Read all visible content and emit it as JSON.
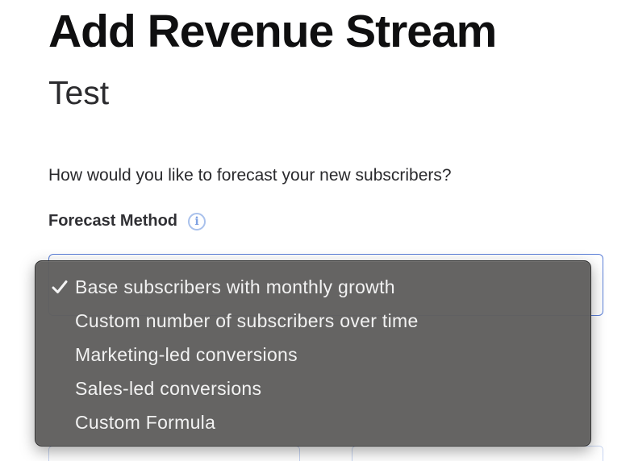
{
  "header": {
    "title": "Add Revenue Stream",
    "subtitle": "Test"
  },
  "form": {
    "question": "How would you like to forecast your new subscribers?",
    "forecast_method": {
      "label": "Forecast Method",
      "info_icon": "info-icon",
      "selected_value": "Base subscribers with monthly growth"
    }
  },
  "dropdown": {
    "items": [
      {
        "label": "Base subscribers with monthly growth",
        "checked": true
      },
      {
        "label": "Custom number of subscribers over time",
        "checked": false
      },
      {
        "label": "Marketing-led conversions",
        "checked": false
      },
      {
        "label": "Sales-led conversions",
        "checked": false
      },
      {
        "label": "Custom Formula",
        "checked": false
      }
    ],
    "check_icon": "checkmark-icon"
  },
  "colors": {
    "accent_border": "#5b7fd8",
    "info_icon": "#a9c1ec",
    "menu_background": "#605f5e",
    "menu_text": "#f2f2f2"
  }
}
